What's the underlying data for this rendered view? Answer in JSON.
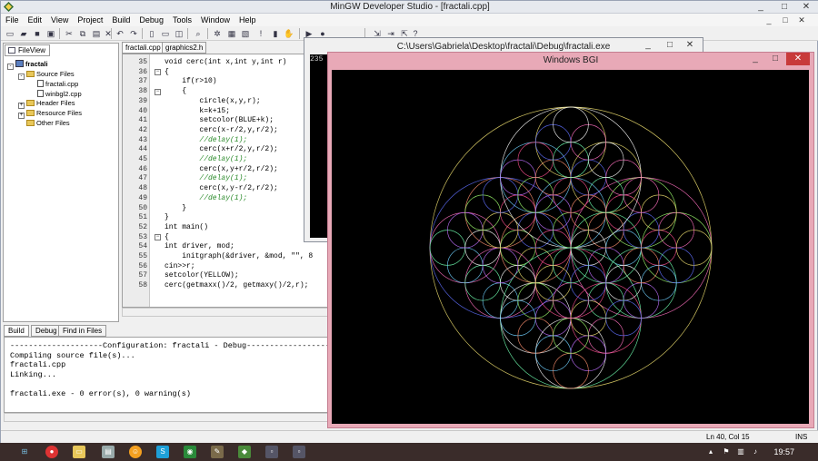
{
  "window": {
    "title": "MinGW Developer Studio - [fractali.cpp]",
    "controls": [
      "_",
      "□",
      "✕"
    ]
  },
  "menu": [
    "File",
    "Edit",
    "View",
    "Project",
    "Build",
    "Debug",
    "Tools",
    "Window",
    "Help"
  ],
  "fileview": {
    "tab": "FileView",
    "tree": [
      {
        "label": "fractali",
        "level": 0,
        "kind": "project",
        "toggle": "-"
      },
      {
        "label": "Source Files",
        "level": 1,
        "kind": "folder",
        "toggle": "-"
      },
      {
        "label": "fractali.cpp",
        "level": 2,
        "kind": "file",
        "toggle": ""
      },
      {
        "label": "winbgl2.cpp",
        "level": 2,
        "kind": "file",
        "toggle": ""
      },
      {
        "label": "Header Files",
        "level": 1,
        "kind": "folder",
        "toggle": "+"
      },
      {
        "label": "Resource Files",
        "level": 1,
        "kind": "folder",
        "toggle": "+"
      },
      {
        "label": "Other Files",
        "level": 1,
        "kind": "folder",
        "toggle": ""
      }
    ]
  },
  "editor": {
    "tabs": [
      "fractali.cpp",
      "graphics2.h"
    ],
    "lines": [
      {
        "n": "35",
        "text": "void cerc(int x,int y,int r)",
        "cls": ""
      },
      {
        "n": "36",
        "text": "{",
        "cls": ""
      },
      {
        "n": "37",
        "text": "    if(r>10)",
        "cls": ""
      },
      {
        "n": "38",
        "text": "    {",
        "cls": ""
      },
      {
        "n": "39",
        "text": "        circle(x,y,r);",
        "cls": ""
      },
      {
        "n": "40",
        "text": "        k=k+15;",
        "cls": ""
      },
      {
        "n": "41",
        "text": "        setcolor(BLUE+k);",
        "cls": ""
      },
      {
        "n": "42",
        "text": "        cerc(x-r/2,y,r/2);",
        "cls": ""
      },
      {
        "n": "43",
        "text": "        //delay(1);",
        "cls": "cm"
      },
      {
        "n": "44",
        "text": "        cerc(x+r/2,y,r/2);",
        "cls": ""
      },
      {
        "n": "45",
        "text": "        //delay(1);",
        "cls": "cm"
      },
      {
        "n": "46",
        "text": "        cerc(x,y+r/2,r/2);",
        "cls": ""
      },
      {
        "n": "47",
        "text": "        //delay(1);",
        "cls": "cm"
      },
      {
        "n": "48",
        "text": "        cerc(x,y-r/2,r/2);",
        "cls": ""
      },
      {
        "n": "49",
        "text": "        //delay(1);",
        "cls": "cm"
      },
      {
        "n": "50",
        "text": "    }",
        "cls": ""
      },
      {
        "n": "51",
        "text": "}",
        "cls": ""
      },
      {
        "n": "52",
        "text": "int main()",
        "cls": ""
      },
      {
        "n": "53",
        "text": "{",
        "cls": ""
      },
      {
        "n": "54",
        "text": "int driver, mod;",
        "cls": ""
      },
      {
        "n": "55",
        "text": "    initgraph(&driver, &mod, \"\", 8",
        "cls": ""
      },
      {
        "n": "56",
        "text": "cin>>r;",
        "cls": ""
      },
      {
        "n": "57",
        "text": "setcolor(YELLOW);",
        "cls": ""
      },
      {
        "n": "58",
        "text": "cerc(getmaxx()/2, getmaxy()/2,r);",
        "cls": ""
      }
    ]
  },
  "output": {
    "tabs": [
      "Build",
      "Debug",
      "Find in Files"
    ],
    "lines": [
      "--------------------Configuration: fractali - Debug--------------------",
      "Compiling source file(s)...",
      "fractali.cpp",
      "Linking...",
      "",
      "fractali.exe - 0 error(s), 0 warning(s)"
    ]
  },
  "statusbar": {
    "position": "Ln 40, Col 15",
    "mode": "INS"
  },
  "console": {
    "title": "C:\\Users\\Gabriela\\Desktop\\fractali\\Debug\\fractali.exe",
    "text": "235"
  },
  "bgi": {
    "title": "Windows BGI",
    "controls": [
      "_",
      "□",
      "✕"
    ]
  },
  "taskbar": {
    "clock": "19:57"
  },
  "colors": {
    "bgi_frame": "#e8a9b7",
    "close_red": "#c83a3a",
    "comment_green": "#2a8a2a",
    "circle_yellow": "#f0e070"
  }
}
